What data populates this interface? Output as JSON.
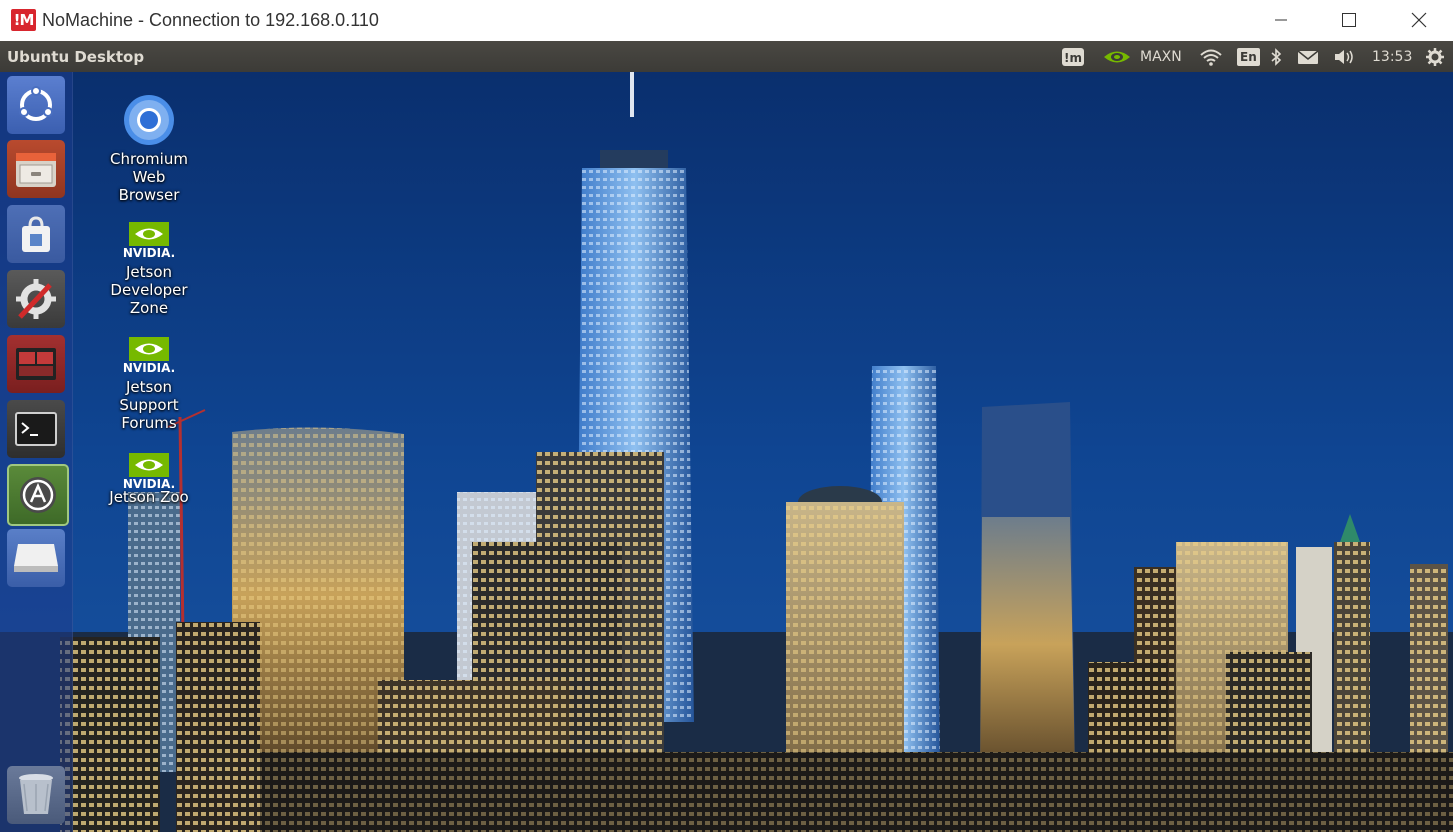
{
  "window": {
    "logo_text": "!M",
    "title": "NoMachine - Connection to 192.168.0.110"
  },
  "panel": {
    "title": "Ubuntu Desktop",
    "power_mode": "MAXN",
    "keyboard_layout": "En",
    "time": "13:53"
  },
  "launcher": {
    "items": [
      {
        "name": "ubuntu-dash",
        "icon": "ubuntu-logo-icon"
      },
      {
        "name": "files",
        "icon": "file-cabinet-icon"
      },
      {
        "name": "software-center",
        "icon": "shopping-bag-icon"
      },
      {
        "name": "system-settings",
        "icon": "gear-wrench-icon"
      },
      {
        "name": "system-monitor",
        "icon": "monitor-panel-icon"
      },
      {
        "name": "terminal",
        "icon": "terminal-icon"
      },
      {
        "name": "software-updater",
        "icon": "updater-icon"
      },
      {
        "name": "drive",
        "icon": "drive-icon"
      },
      {
        "name": "trash",
        "icon": "trash-icon"
      }
    ]
  },
  "desktop_icons": [
    {
      "line1": "Chromium",
      "line2": "Web",
      "line3": "Browser",
      "icon": "chromium-icon"
    },
    {
      "line1": "Jetson",
      "line2": "Developer",
      "line3": "Zone",
      "icon": "nvidia-icon",
      "brand": "NVIDIA."
    },
    {
      "line1": "Jetson",
      "line2": "Support",
      "line3": "Forums",
      "icon": "nvidia-icon",
      "brand": "NVIDIA."
    },
    {
      "line1": "Jetson Zoo",
      "icon": "nvidia-icon",
      "brand": "NVIDIA."
    }
  ],
  "colors": {
    "nomachine_red": "#d8262e",
    "panel_bg": "#3c3b37",
    "nvidia_green": "#76b900",
    "launcher_bg": "#1e3c8c"
  }
}
